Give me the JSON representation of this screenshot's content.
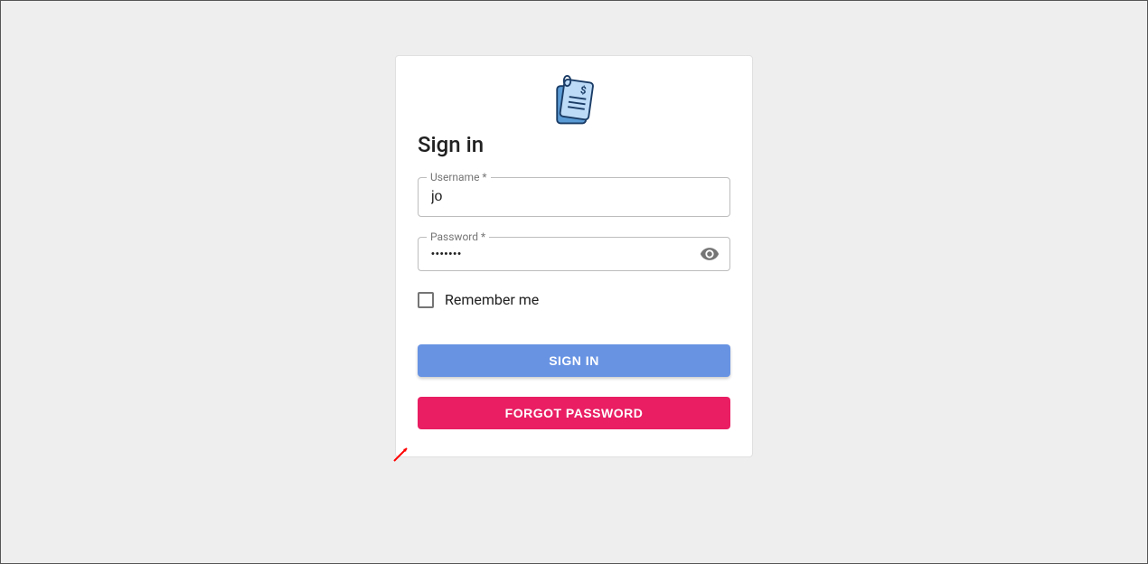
{
  "title": "Sign in",
  "username": {
    "label": "Username *",
    "value": "jo"
  },
  "password": {
    "label": "Password *",
    "value": "•••••••"
  },
  "remember_label": "Remember me",
  "signin_button": "Sign In",
  "forgot_button": "Forgot Password"
}
